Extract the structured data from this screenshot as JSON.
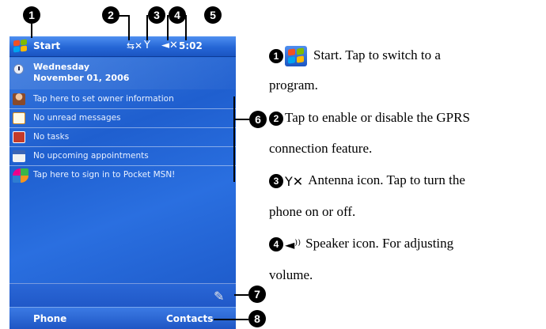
{
  "device": {
    "title_bar": {
      "start_label": "Start",
      "gprs_icon": "gprs-disconnected-icon",
      "antenna_icon": "antenna-off-icon",
      "speaker_icon": "speaker-muted-icon",
      "clock": "5:02"
    },
    "today": {
      "day": "Wednesday",
      "date": "November 01, 2006",
      "items": [
        {
          "icon": "owner-icon",
          "text": "Tap here to set owner information"
        },
        {
          "icon": "mail-icon",
          "text": "No unread messages"
        },
        {
          "icon": "tasks-icon",
          "text": "No tasks"
        },
        {
          "icon": "calendar-icon",
          "text": "No upcoming appointments"
        },
        {
          "icon": "msn-butterfly-icon",
          "text": "Tap here to sign in to Pocket MSN!"
        }
      ]
    },
    "softkeys": {
      "left": "Phone",
      "right": "Contacts"
    },
    "input_panel_icon": "input-panel-icon"
  },
  "callouts": [
    "1",
    "2",
    "3",
    "4",
    "5",
    "6",
    "7",
    "8"
  ],
  "descriptions": [
    {
      "num": "1",
      "text_a": "Start. Tap to switch to a",
      "text_b": "program."
    },
    {
      "num": "2",
      "text_a": "Tap to enable or disable the GPRS",
      "text_b": "connection feature."
    },
    {
      "num": "3",
      "text_a": "Antenna icon. Tap to turn the",
      "text_b": "phone on or off."
    },
    {
      "num": "4",
      "text_a": "Speaker icon. For adjusting",
      "text_b": "volume."
    }
  ],
  "colors": {
    "screen_blue": "#2566d6",
    "callout_black": "#000000"
  }
}
